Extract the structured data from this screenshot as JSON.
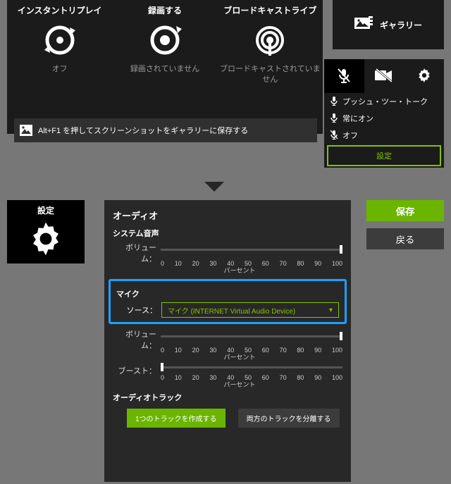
{
  "topPanel": {
    "items": [
      {
        "title": "インスタントリプレイ",
        "status": "オフ"
      },
      {
        "title": "録画する",
        "status": "録画されていません"
      },
      {
        "title": "ブロードキャストライブ",
        "status": "ブロードキャストされていません"
      }
    ],
    "hint": "Alt+F1 を押してスクリーンショットをギャラリーに保存する"
  },
  "gallery": {
    "label": "ギャラリー"
  },
  "micMenu": {
    "items": [
      {
        "label": "プッシュ・ツー・トーク"
      },
      {
        "label": "常にオン"
      },
      {
        "label": "オフ"
      }
    ],
    "activeLabel": "設定"
  },
  "settings": {
    "sideLabel": "設定",
    "saveLabel": "保存",
    "backLabel": "戻る",
    "audioHeader": "オーディオ",
    "systemAudio": "システム音声",
    "volumeLabel": "ボリューム：",
    "percentLabel": "パーセント",
    "ticks": [
      "0",
      "10",
      "20",
      "30",
      "40",
      "50",
      "60",
      "70",
      "80",
      "90",
      "100"
    ],
    "micHeader": "マイク",
    "sourceLabel": "ソース：",
    "sourceValue": "マイク (INTERNET Virtual Audio Device)",
    "boostLabel": "ブースト：",
    "tracksHeader": "オーディオトラック",
    "trackBtn1": "1つのトラックを作成する",
    "trackBtn2": "両方のトラックを分離する",
    "systemVolume": 100,
    "micVolume": 100,
    "boost": 0
  }
}
